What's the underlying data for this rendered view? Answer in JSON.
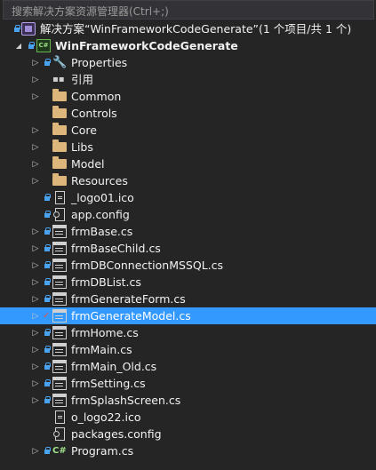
{
  "search": {
    "placeholder": "搜索解决方案资源管理器(Ctrl+;)"
  },
  "tree": {
    "solution": {
      "label": "解决方案“WinFrameworkCodeGenerate”(1 个项目/共 1 个)",
      "icon": "solution-icon"
    },
    "project": {
      "label": "WinFrameworkCodeGenerate",
      "icon": "csharp-project-icon"
    },
    "items": [
      {
        "label": "Properties",
        "icon": "wrench-icon",
        "expander": true,
        "lock": true
      },
      {
        "label": "引用",
        "icon": "references-icon",
        "expander": true,
        "lock": false
      },
      {
        "label": "Common",
        "icon": "folder-icon",
        "expander": true,
        "lock": false
      },
      {
        "label": "Controls",
        "icon": "folder-icon",
        "expander": false,
        "lock": false
      },
      {
        "label": "Core",
        "icon": "folder-icon",
        "expander": true,
        "lock": false
      },
      {
        "label": "Libs",
        "icon": "folder-icon",
        "expander": true,
        "lock": false
      },
      {
        "label": "Model",
        "icon": "folder-icon",
        "expander": true,
        "lock": false
      },
      {
        "label": "Resources",
        "icon": "folder-icon",
        "expander": true,
        "lock": false
      },
      {
        "label": "_logo01.ico",
        "icon": "ico-file-icon",
        "expander": false,
        "lock": true
      },
      {
        "label": "app.config",
        "icon": "config-file-icon",
        "expander": false,
        "lock": true
      },
      {
        "label": "frmBase.cs",
        "icon": "form-icon",
        "expander": true,
        "lock": true
      },
      {
        "label": "frmBaseChild.cs",
        "icon": "form-icon",
        "expander": true,
        "lock": true
      },
      {
        "label": "frmDBConnectionMSSQL.cs",
        "icon": "form-icon",
        "expander": true,
        "lock": true
      },
      {
        "label": "frmDBList.cs",
        "icon": "form-icon",
        "expander": true,
        "lock": true
      },
      {
        "label": "frmGenerateForm.cs",
        "icon": "form-icon",
        "expander": true,
        "lock": true
      },
      {
        "label": "frmGenerateModel.cs",
        "icon": "form-icon",
        "expander": true,
        "lock": false,
        "checked": true,
        "selected": true
      },
      {
        "label": "frmHome.cs",
        "icon": "form-icon",
        "expander": true,
        "lock": true
      },
      {
        "label": "frmMain.cs",
        "icon": "form-icon",
        "expander": true,
        "lock": true
      },
      {
        "label": "frmMain_Old.cs",
        "icon": "form-icon",
        "expander": true,
        "lock": true
      },
      {
        "label": "frmSetting.cs",
        "icon": "form-icon",
        "expander": true,
        "lock": true
      },
      {
        "label": "frmSplashScreen.cs",
        "icon": "form-icon",
        "expander": true,
        "lock": true
      },
      {
        "label": "o_logo22.ico",
        "icon": "ico-file-icon",
        "expander": false,
        "lock": false
      },
      {
        "label": "packages.config",
        "icon": "config-file-icon",
        "expander": false,
        "lock": false
      },
      {
        "label": "Program.cs",
        "icon": "csharp-file-icon",
        "expander": true,
        "lock": true
      }
    ]
  },
  "colors": {
    "background": "#252526",
    "selection": "#3399ff",
    "lock": "#4aa3f0",
    "folder": "#dcb67a"
  }
}
